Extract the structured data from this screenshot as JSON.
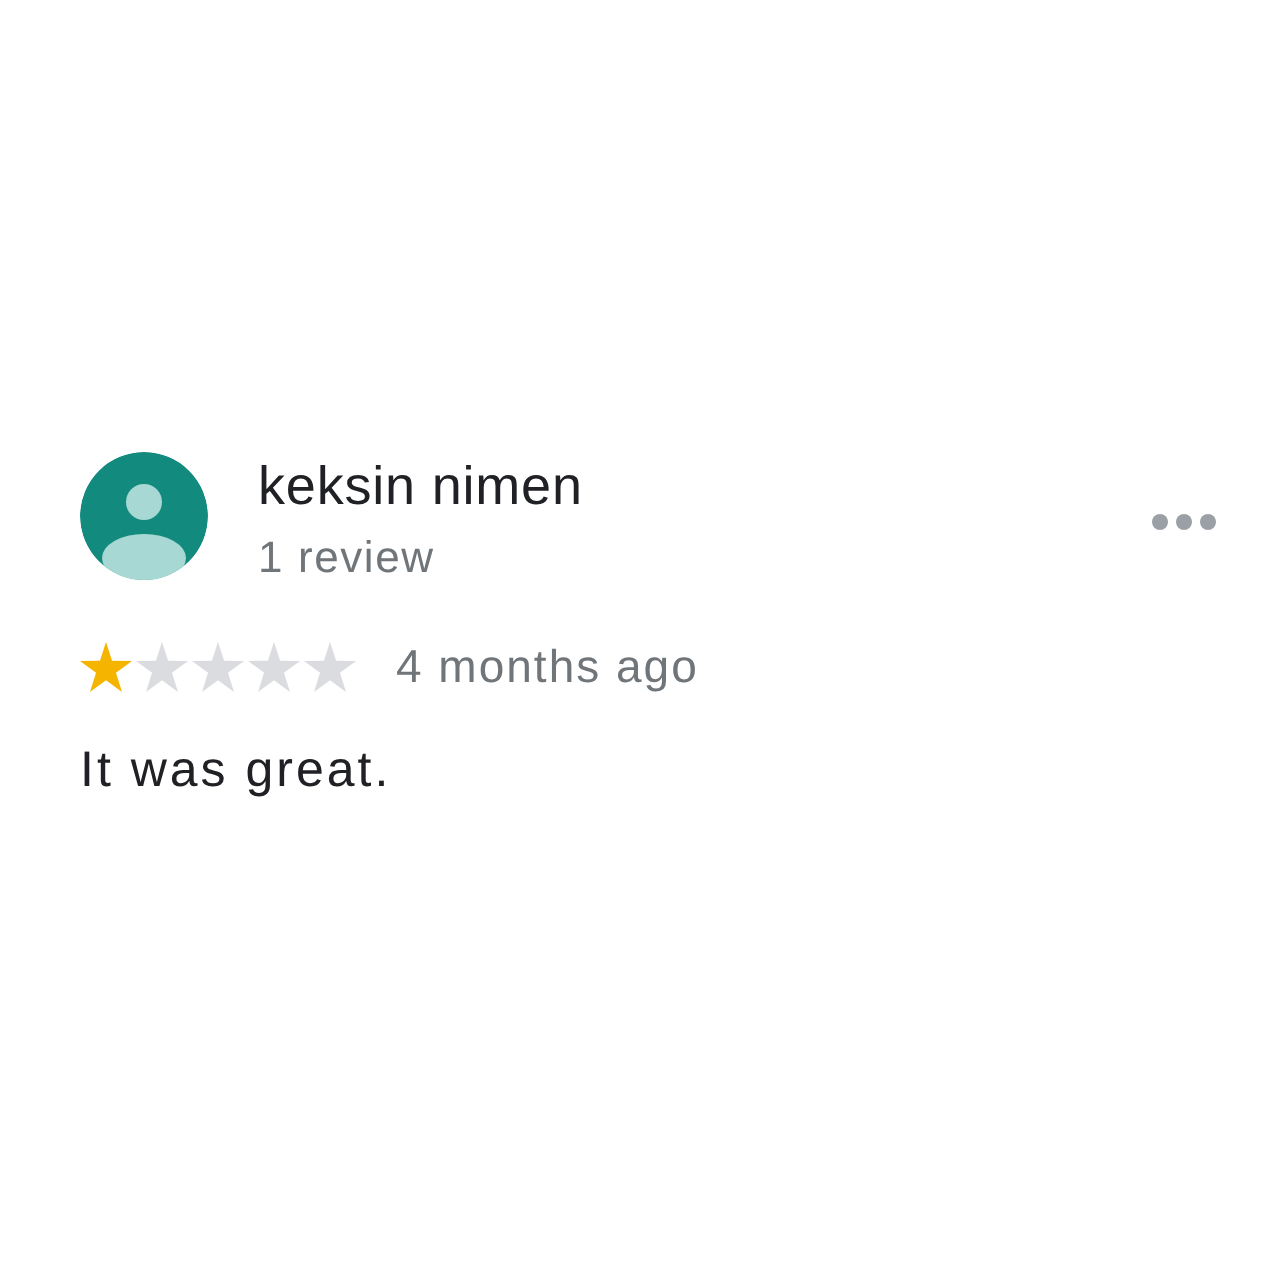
{
  "review": {
    "author": "keksin nimen",
    "author_meta": "1 review",
    "stars": 1,
    "time": "4 months ago",
    "text": "It was great."
  }
}
